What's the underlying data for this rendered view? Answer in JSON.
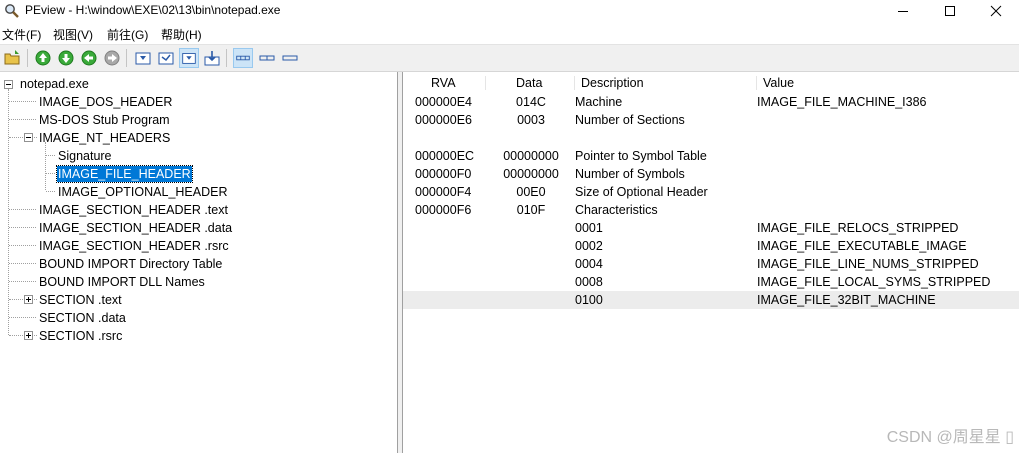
{
  "window": {
    "title": "PEview - H:\\window\\EXE\\02\\13\\bin\\notepad.exe"
  },
  "menu": [
    "文件(F)",
    "视图(V)",
    "前往(G)",
    "帮助(H)"
  ],
  "toolbar": {
    "buttons": [
      "open-file",
      "go-up",
      "go-down",
      "go-back",
      "go-forward",
      "view-hex",
      "view-value",
      "view-both",
      "view-details-active",
      "layout-list",
      "layout-wide",
      "layout-narrow"
    ]
  },
  "tree": {
    "root": "notepad.exe",
    "items": [
      "IMAGE_DOS_HEADER",
      "MS-DOS Stub Program",
      "IMAGE_NT_HEADERS",
      "Signature",
      "IMAGE_FILE_HEADER",
      "IMAGE_OPTIONAL_HEADER",
      "IMAGE_SECTION_HEADER .text",
      "IMAGE_SECTION_HEADER .data",
      "IMAGE_SECTION_HEADER .rsrc",
      "BOUND IMPORT Directory Table",
      "BOUND IMPORT DLL Names",
      "SECTION .text",
      "SECTION .data",
      "SECTION .rsrc"
    ],
    "selected": "IMAGE_FILE_HEADER"
  },
  "list": {
    "columns": [
      "RVA",
      "Data",
      "Description",
      "Value"
    ],
    "rows": [
      [
        "000000E4",
        "014C",
        "Machine",
        "IMAGE_FILE_MACHINE_I386"
      ],
      [
        "000000E6",
        "0003",
        "Number of Sections",
        ""
      ],
      [
        "",
        "",
        "",
        ""
      ],
      [
        "000000EC",
        "00000000",
        "Pointer to Symbol Table",
        ""
      ],
      [
        "000000F0",
        "00000000",
        "Number of Symbols",
        ""
      ],
      [
        "000000F4",
        "00E0",
        "Size of Optional Header",
        ""
      ],
      [
        "000000F6",
        "010F",
        "Characteristics",
        ""
      ],
      [
        "",
        "",
        "0001",
        "IMAGE_FILE_RELOCS_STRIPPED"
      ],
      [
        "",
        "",
        "0002",
        "IMAGE_FILE_EXECUTABLE_IMAGE"
      ],
      [
        "",
        "",
        "0004",
        "IMAGE_FILE_LINE_NUMS_STRIPPED"
      ],
      [
        "",
        "",
        "0008",
        "IMAGE_FILE_LOCAL_SYMS_STRIPPED"
      ],
      [
        "",
        "",
        "0100",
        "IMAGE_FILE_32BIT_MACHINE"
      ]
    ]
  },
  "watermark": "CSDN @周星星 ▯",
  "colors": {
    "selection": "#0078d7",
    "row_highlight": "#ececec",
    "toolbar_bg": "#f0f0f0"
  }
}
